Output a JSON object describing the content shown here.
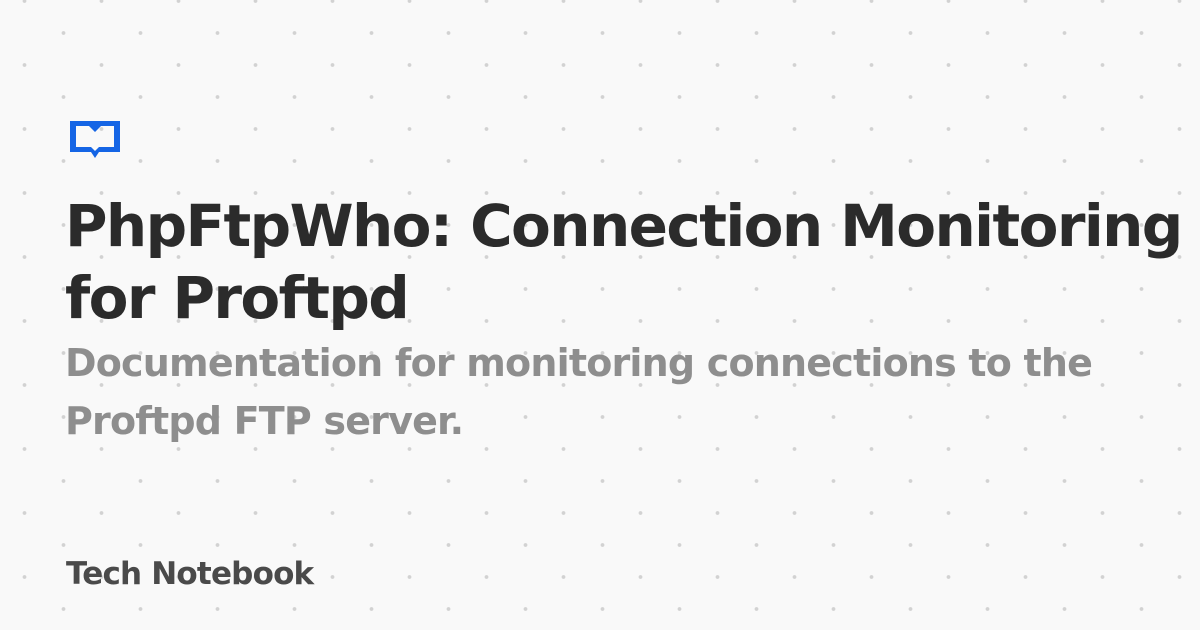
{
  "logo": {
    "icon": "open-book-icon",
    "color": "#1565e5"
  },
  "title": "PhpFtpWho: Connection Monitoring for Proftpd",
  "subtitle": "Documentation for monitoring connections to the Proftpd FTP server.",
  "site_name": "Tech Notebook"
}
